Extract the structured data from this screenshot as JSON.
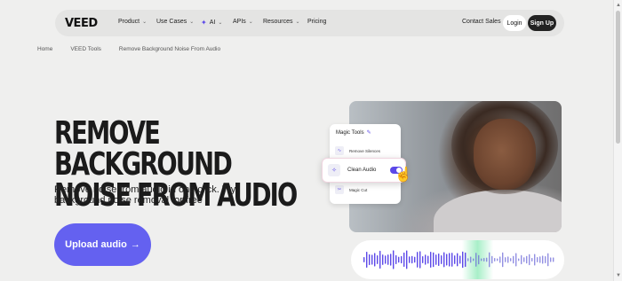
{
  "header": {
    "logo": "VEED",
    "nav": [
      {
        "label": "Product",
        "dropdown": true
      },
      {
        "label": "Use Cases",
        "dropdown": true
      },
      {
        "label": "AI",
        "dropdown": true,
        "icon": "sparkle-icon"
      },
      {
        "label": "APIs",
        "dropdown": true
      },
      {
        "label": "Resources",
        "dropdown": true
      },
      {
        "label": "Pricing",
        "dropdown": false
      }
    ],
    "contact": "Contact Sales",
    "login": "Login",
    "signup": "Sign Up"
  },
  "breadcrumb": [
    "Home",
    "VEED Tools",
    "Remove Background Noise From Audio"
  ],
  "hero": {
    "title_line1": "REMOVE BACKGROUND",
    "title_line2": "NOISE FROM AUDIO",
    "subtitle": "Remove noise from audio in one click. Try background noise removal for free",
    "cta": "Upload audio",
    "cta_arrow": "→"
  },
  "magic_tools": {
    "title": "Magic Tools",
    "items": [
      "Remove Silences",
      "Clean Audio",
      "Magic Cut"
    ],
    "active": "Clean Audio",
    "toggle_on": true
  },
  "colors": {
    "accent": "#6461f0",
    "background": "#efefee",
    "dark_button": "#222222"
  }
}
